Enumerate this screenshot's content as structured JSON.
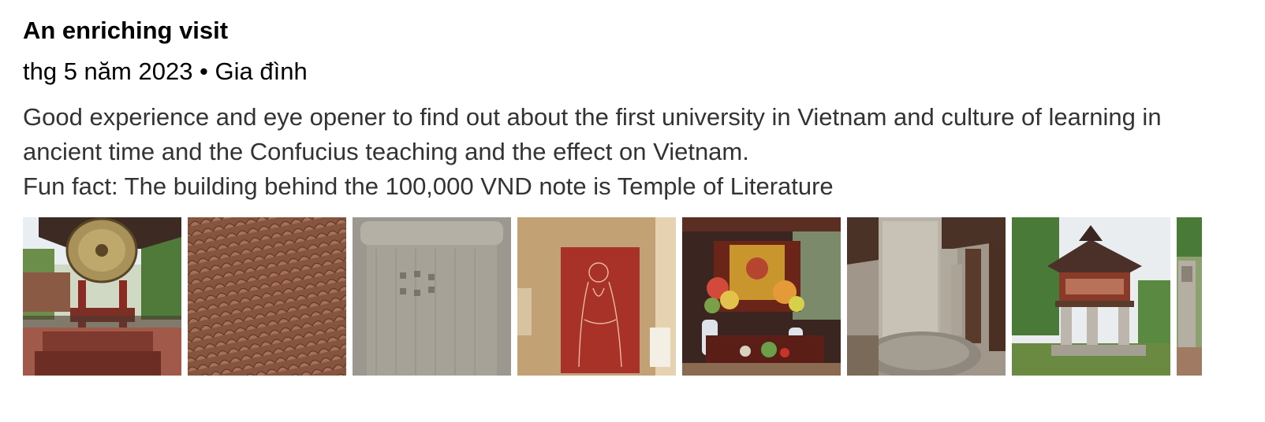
{
  "review": {
    "title": "An enriching visit",
    "meta": "thg 5 năm 2023 • Gia đình",
    "body_lines": [
      "Good experience and eye opener to find out about the first university in Vietnam and culture of learning in",
      "ancient time and the Confucius teaching and the effect on Vietnam.",
      "Fun fact: The building behind the 100,000 VND note is Temple of Literature"
    ]
  },
  "photos": [
    {
      "subject": "temple-drum-pavilion-photo"
    },
    {
      "subject": "roof-tiles-photo"
    },
    {
      "subject": "stone-stele-inscription-photo"
    },
    {
      "subject": "confucius-portrait-panel-photo"
    },
    {
      "subject": "altar-with-flowers-photo"
    },
    {
      "subject": "stelae-on-turtles-photo"
    },
    {
      "subject": "khue-van-cac-pavilion-photo"
    },
    {
      "subject": "gate-partial-photo"
    }
  ]
}
